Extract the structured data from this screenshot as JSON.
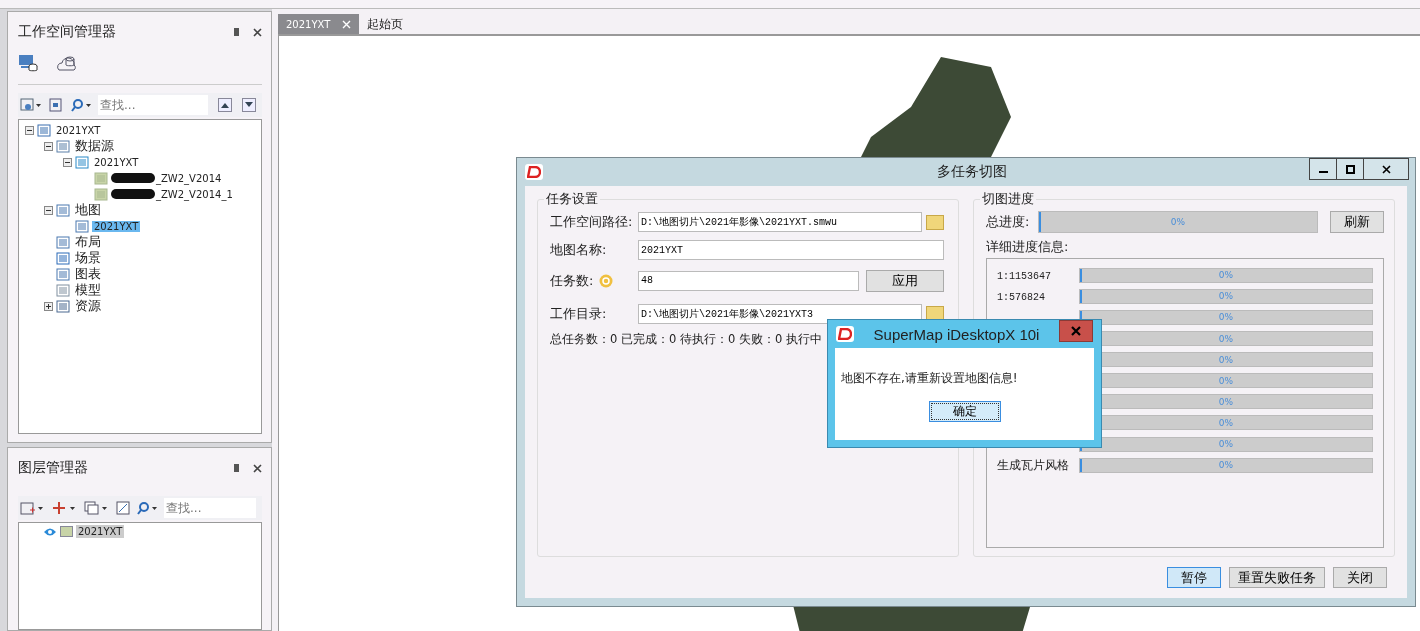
{
  "workspace_manager": {
    "title": "工作空间管理器",
    "search": {
      "placeholder": "查找..."
    },
    "tree": [
      {
        "label": "2021YXT",
        "kind": "workspace",
        "expanded": true,
        "selected": false,
        "children": [
          {
            "label": "数据源",
            "kind": "datasources",
            "expanded": true,
            "selected": false,
            "children": [
              {
                "label": "2021YXT",
                "kind": "udx",
                "expanded": true,
                "selected": false,
                "children": [
                  {
                    "label": "_ZW2_V2014",
                    "kind": "dataset",
                    "redacted": true,
                    "selected": false
                  },
                  {
                    "label": "_ZW2_V2014_1",
                    "kind": "dataset",
                    "redacted": true,
                    "selected": false
                  }
                ]
              }
            ]
          },
          {
            "label": "地图",
            "kind": "maps",
            "expanded": true,
            "selected": false,
            "children": [
              {
                "label": "2021YXT",
                "kind": "map",
                "selected": true
              }
            ]
          },
          {
            "label": "布局",
            "kind": "layouts",
            "selected": false
          },
          {
            "label": "场景",
            "kind": "scenes",
            "selected": false
          },
          {
            "label": "图表",
            "kind": "charts",
            "selected": false
          },
          {
            "label": "模型",
            "kind": "models",
            "selected": false
          },
          {
            "label": "资源",
            "kind": "resources",
            "expanded": false,
            "selected": false
          }
        ]
      }
    ]
  },
  "layer_manager": {
    "title": "图层管理器",
    "search": {
      "placeholder": "查找..."
    },
    "layers": [
      {
        "label": "2021YXT",
        "visible": true,
        "selected": true
      }
    ]
  },
  "document_tabs": [
    {
      "label": "2021YXT",
      "selected": true,
      "closable": true
    },
    {
      "label": "起始页",
      "selected": false,
      "closable": false
    }
  ],
  "tile_dialog": {
    "title": "多任务切图",
    "task_settings": {
      "title": "任务设置",
      "workspace_path_label": "工作空间路径:",
      "workspace_path": "D:\\地图切片\\2021年影像\\2021YXT.smwu",
      "map_name_label": "地图名称:",
      "map_name": "2021YXT",
      "task_count_label": "任务数:",
      "task_count": "48",
      "apply_button": "应用",
      "work_dir_label": "工作目录:",
      "work_dir": "D:\\地图切片\\2021年影像\\2021YXT3",
      "summary": "总任务数：0 已完成：0 待执行：0 失败：0 执行中"
    },
    "progress": {
      "title": "切图进度",
      "total_label": "总进度:",
      "total": {
        "level": 0,
        "reading": "0%"
      },
      "refresh_button": "刷新",
      "detail_label": "详细进度信息:",
      "rows": [
        {
          "label": "1:1153647",
          "level": 0,
          "reading": "0%"
        },
        {
          "label": "1:576824",
          "level": 0,
          "reading": "0%"
        },
        {
          "level": 0,
          "reading": "0%"
        },
        {
          "level": 0,
          "reading": "0%"
        },
        {
          "level": 0,
          "reading": "0%"
        },
        {
          "level": 0,
          "reading": "0%"
        },
        {
          "level": 0,
          "reading": "0%"
        },
        {
          "level": 0,
          "reading": "0%"
        },
        {
          "level": 0,
          "reading": "0%"
        },
        {
          "label": "生成瓦片风格",
          "level": 0,
          "reading": "0%"
        }
      ]
    },
    "buttons": [
      {
        "label": "暂停",
        "selected": true
      },
      {
        "label": "重置失败任务",
        "selected": false
      },
      {
        "label": "关闭",
        "selected": false
      }
    ]
  },
  "message_box": {
    "title": "SuperMap iDesktopX 10i",
    "message": "地图不存在,请重新设置地图信息!",
    "ok_button": "确定"
  }
}
